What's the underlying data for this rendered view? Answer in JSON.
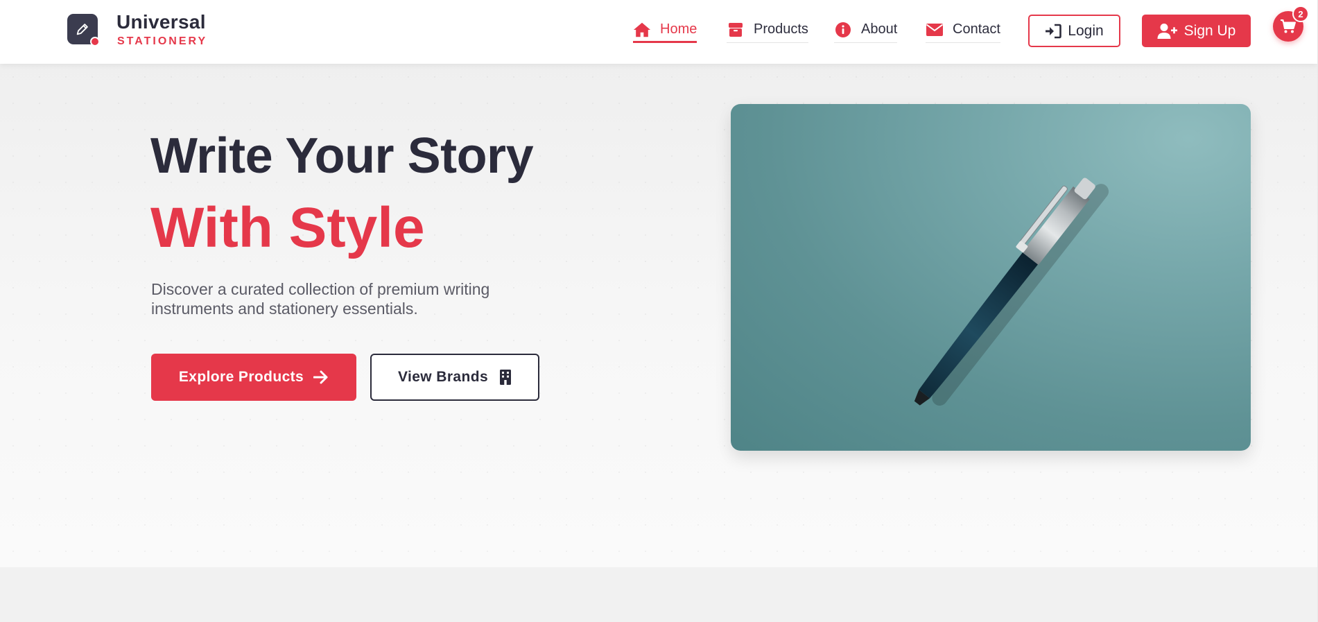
{
  "brand": {
    "name": "Universal",
    "tagline": "STATIONERY",
    "logo_icon": "pencil-icon"
  },
  "nav": {
    "items": [
      {
        "label": "Home",
        "icon": "home-icon",
        "active": true
      },
      {
        "label": "Products",
        "icon": "box-icon",
        "active": false
      },
      {
        "label": "About",
        "icon": "info-icon",
        "active": false
      },
      {
        "label": "Contact",
        "icon": "envelope-icon",
        "active": false
      }
    ],
    "login_label": "Login",
    "signup_label": "Sign Up",
    "cart_count": "2"
  },
  "hero": {
    "headline_line1": "Write Your Story",
    "headline_line2": "With Style",
    "description": "Discover a curated collection of premium writing instruments and stationery essentials.",
    "primary_button": "Explore Products",
    "secondary_button": "View Brands"
  },
  "colors": {
    "accent": "#e5384a",
    "dark": "#2b2b3b",
    "image_background": "#6a9ea1"
  }
}
